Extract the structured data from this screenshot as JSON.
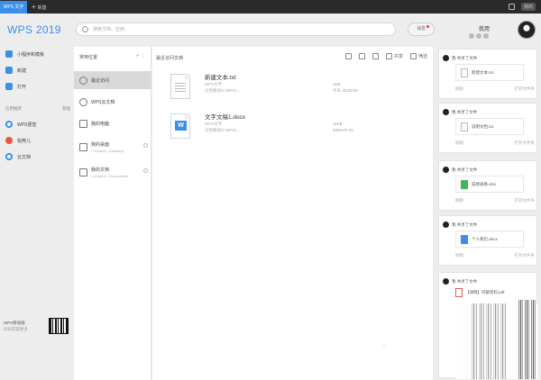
{
  "titlebar": {
    "active_tab": "WPS 文字",
    "new_tab": "新建",
    "user": "我的"
  },
  "topbar": {
    "logo": "WPS 2019",
    "search_placeholder": "搜索文档、应用…",
    "messages": "消息",
    "username": "我用"
  },
  "sidebar": {
    "items": [
      {
        "label": "小程序和模板",
        "icon": "app-store-icon"
      },
      {
        "label": "新建",
        "icon": "new-file-icon"
      },
      {
        "label": "打开",
        "icon": "folder-icon"
      }
    ],
    "section_title": "应用推荐",
    "section_action": "管理",
    "apps": [
      {
        "label": "WPS便签",
        "icon": "note-icon"
      },
      {
        "label": "稻壳儿",
        "icon": "docer-icon"
      },
      {
        "label": "云文档",
        "icon": "cloud-doc-icon"
      }
    ],
    "footer_title": "WPS移动版",
    "footer_sub": "扫码获取更多"
  },
  "nav": {
    "header": "常用位置",
    "items": [
      {
        "label": "最近访问",
        "sub": ""
      },
      {
        "label": "WPS云文档",
        "sub": ""
      },
      {
        "label": "我的电脑",
        "sub": ""
      },
      {
        "label": "我的桌面",
        "sub": "C:\\Users\\...\\Desktop"
      },
      {
        "label": "我的文档",
        "sub": "C:\\Users\\...\\Documents"
      }
    ]
  },
  "main": {
    "title": "最近访问文档",
    "tools": {
      "share": "共享",
      "filter": "筛选"
    },
    "files": [
      {
        "name": "新建文本.txt",
        "type": "WPS文字",
        "path": "文档路径D:\\WPS\\...",
        "size": "1KB",
        "date": "今天 20:00:00"
      },
      {
        "name": "文字文稿1.docx",
        "type": "WPS文字",
        "path": "文档路径D:\\WPS\\...",
        "size": "11KB",
        "date": "2020-07-21"
      }
    ]
  },
  "feed": {
    "cards": [
      {
        "user": "我 共享了文件",
        "file": "新建文本.txt",
        "time": "刚刚",
        "action": "打开文件夹"
      },
      {
        "user": "我 共享了文件",
        "file": "说明文档.txt",
        "time": "刚刚",
        "action": "打开文件夹"
      },
      {
        "user": "我 共享了文件",
        "file": "成绩表格.xlsx",
        "time": "刚刚",
        "action": "打开文件夹"
      },
      {
        "user": "我 共享了文件",
        "file": "个人简历.docx",
        "time": "刚刚",
        "action": "打开文件夹"
      },
      {
        "user": "我 共享了文件",
        "file": "【详情】内部资料.pdf",
        "time": "",
        "action": ""
      }
    ]
  },
  "colors": {
    "accent": "#3b8fe8",
    "red": "#e8574a",
    "green": "#45b35e"
  }
}
